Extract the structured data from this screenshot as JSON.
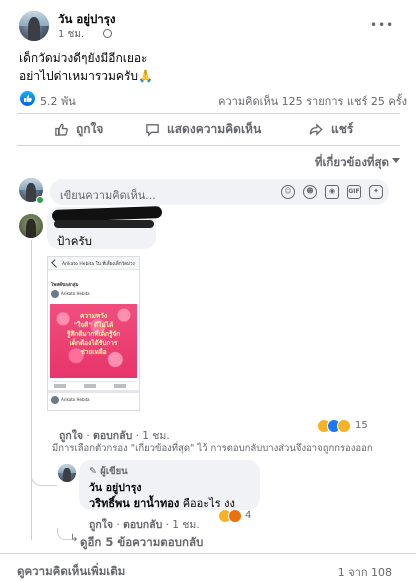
{
  "post": {
    "author": "วัน อยู่ปารุง",
    "time": "1 ชม.",
    "text_lines": [
      "เด็กวัดม่วงดีๆยังมีอีกเยอะ",
      "อย่าไปด่าเหมารวมครับ🙏"
    ],
    "like_count": "5.2 พัน",
    "comments_shares": "ความคิดเห็น 125 รายการ  แชร์ 25 ครั้ง"
  },
  "actions": {
    "like": "ถูกใจ",
    "comment": "แสดงความคิดเห็น",
    "share": "แชร์"
  },
  "sort": {
    "label": "ที่เกี่ยวข้องที่สุด"
  },
  "composer": {
    "placeholder": "เขียนความคิดเห็น...",
    "tools": [
      "emoji-icon",
      "camera-icon",
      "gif-icon",
      "sticker-icon"
    ]
  },
  "comment1": {
    "text": "ป้าครับ",
    "screenshot": {
      "header": "Arikato Hebita ใน ที่เลี้ยงเด็กวัดม่วง",
      "subheader": "โพสต์ของกลุ่ม",
      "poster": "Arikato Hebita",
      "image_text": [
        "ความหวัง",
        "\"ใจดี\" ดีไม่ได้",
        "รู้สึกดีมากที่เด็กรู้จัก",
        "เด็กต้องได้รับการ",
        "ช่วยเหลือ"
      ],
      "bottom_poster": "Arikato Hebita"
    },
    "like": "ถูกใจ",
    "reply": "ตอบกลับ",
    "time": "1 ชม.",
    "reaction_count": "15",
    "note": "มีการเลือกตัวกรอง \"เกี่ยวข้องที่สุด\" ไว้ การตอบกลับบางส่วนจึงอาจถูกกรองออก"
  },
  "reply1": {
    "badge": "ผู้เขียน",
    "author": "วัน อยู่ปารุง",
    "tagged": "วริทธิ์พน ยาน้ำทอง",
    "text": "คืออะไร งง",
    "like": "ถูกใจ",
    "reply": "ตอบกลับ",
    "time": "1 ชม.",
    "reaction_count": "4"
  },
  "more_replies": "ดูอีก 5 ข้อความตอบกลับ",
  "footer": {
    "view_more": "ดูความคิดเห็นเพิ่มเติม",
    "count": "1 จาก 108"
  },
  "colors": {
    "accent": "#1877f2",
    "muted": "#65676b",
    "bubble": "#f0f2f5",
    "divider": "#ced0d4"
  }
}
